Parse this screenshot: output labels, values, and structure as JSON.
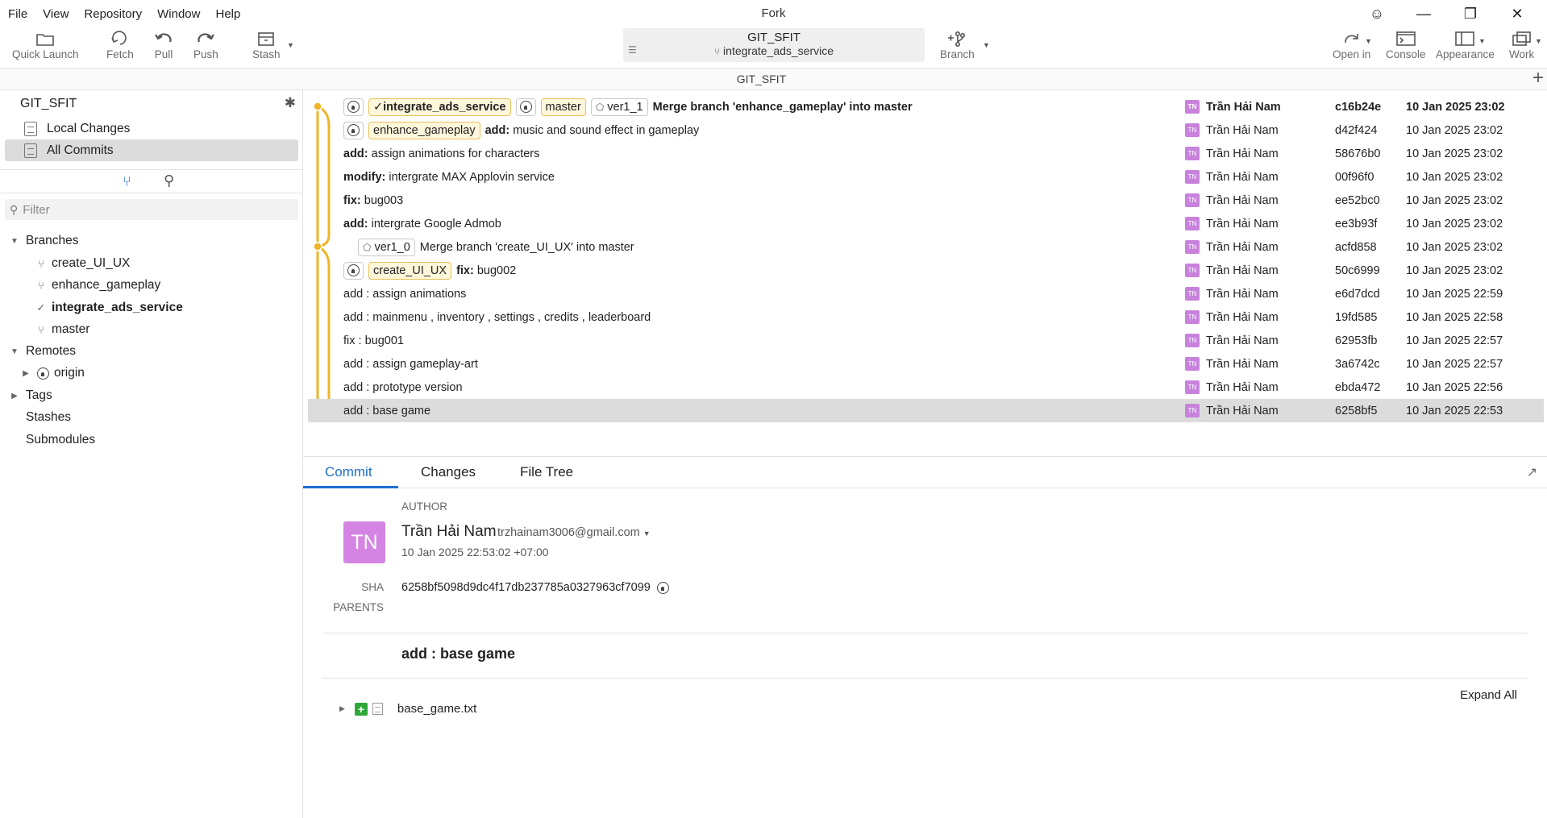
{
  "app": {
    "title": "Fork"
  },
  "menu": [
    "File",
    "View",
    "Repository",
    "Window",
    "Help"
  ],
  "toolbar": {
    "quick_launch": "Quick Launch",
    "fetch": "Fetch",
    "pull": "Pull",
    "push": "Push",
    "stash": "Stash",
    "repo_name": "GIT_SFIT",
    "current_branch": "integrate_ads_service",
    "branch": "Branch",
    "open_in": "Open in",
    "console": "Console",
    "appearance": "Appearance",
    "work": "Work"
  },
  "tab": {
    "title": "GIT_SFIT"
  },
  "sidebar": {
    "repo": "GIT_SFIT",
    "local_changes": "Local Changes",
    "all_commits": "All Commits",
    "filter_placeholder": "Filter",
    "branches_label": "Branches",
    "branches": [
      "create_UI_UX",
      "enhance_gameplay",
      "integrate_ads_service",
      "master"
    ],
    "current_branch_index": 2,
    "remotes_label": "Remotes",
    "remotes": [
      "origin"
    ],
    "tags_label": "Tags",
    "stashes_label": "Stashes",
    "submodules_label": "Submodules"
  },
  "commits": [
    {
      "refs": [
        {
          "kind": "github"
        },
        {
          "kind": "branch",
          "label": "integrate_ads_service",
          "current": true
        },
        {
          "kind": "github"
        },
        {
          "kind": "branch",
          "label": "master"
        },
        {
          "kind": "tag",
          "label": "ver1_1"
        }
      ],
      "prefix": "",
      "subject": "Merge branch 'enhance_gameplay' into master",
      "author": "Trần Hải Nam",
      "initials": "TN",
      "sha": "c16b24e",
      "date": "10 Jan 2025 23:02",
      "head": true
    },
    {
      "refs": [
        {
          "kind": "github"
        },
        {
          "kind": "branch",
          "label": "enhance_gameplay"
        }
      ],
      "prefix": "add:",
      "subject": " music and sound effect in gameplay",
      "author": "Trần Hải Nam",
      "initials": "TN",
      "sha": "d42f424",
      "date": "10 Jan 2025 23:02"
    },
    {
      "refs": [],
      "prefix": "add:",
      "subject": " assign animations for characters",
      "author": "Trần Hải Nam",
      "initials": "TN",
      "sha": "58676b0",
      "date": "10 Jan 2025 23:02"
    },
    {
      "refs": [],
      "prefix": "modify:",
      "subject": " intergrate MAX Applovin service",
      "author": "Trần Hải Nam",
      "initials": "TN",
      "sha": "00f96f0",
      "date": "10 Jan 2025 23:02"
    },
    {
      "refs": [],
      "prefix": "fix:",
      "subject": " bug003",
      "author": "Trần Hải Nam",
      "initials": "TN",
      "sha": "ee52bc0",
      "date": "10 Jan 2025 23:02"
    },
    {
      "refs": [],
      "prefix": "add:",
      "subject": " intergrate Google Admob",
      "author": "Trần Hải Nam",
      "initials": "TN",
      "sha": "ee3b93f",
      "date": "10 Jan 2025 23:02"
    },
    {
      "refs": [
        {
          "kind": "tag",
          "label": "ver1_0"
        }
      ],
      "prefix": "",
      "subject": "Merge branch 'create_UI_UX' into master",
      "author": "Trần Hải Nam",
      "initials": "TN",
      "sha": "acfd858",
      "date": "10 Jan 2025 23:02",
      "indent": true
    },
    {
      "refs": [
        {
          "kind": "github"
        },
        {
          "kind": "branch",
          "label": "create_UI_UX"
        }
      ],
      "prefix": "fix:",
      "subject": " bug002",
      "author": "Trần Hải Nam",
      "initials": "TN",
      "sha": "50c6999",
      "date": "10 Jan 2025 23:02"
    },
    {
      "refs": [],
      "prefix": "",
      "subject": "add : assign animations",
      "author": "Trần Hải Nam",
      "initials": "TN",
      "sha": "e6d7dcd",
      "date": "10 Jan 2025 22:59"
    },
    {
      "refs": [],
      "prefix": "",
      "subject": "add : mainmenu , inventory , settings , credits , leaderboard",
      "author": "Trần Hải Nam",
      "initials": "TN",
      "sha": "19fd585",
      "date": "10 Jan 2025 22:58"
    },
    {
      "refs": [],
      "prefix": "",
      "subject": "fix : bug001",
      "author": "Trần Hải Nam",
      "initials": "TN",
      "sha": "62953fb",
      "date": "10 Jan 2025 22:57"
    },
    {
      "refs": [],
      "prefix": "",
      "subject": "add : assign gameplay-art",
      "author": "Trần Hải Nam",
      "initials": "TN",
      "sha": "3a6742c",
      "date": "10 Jan 2025 22:57"
    },
    {
      "refs": [],
      "prefix": "",
      "subject": "add : prototype version",
      "author": "Trần Hải Nam",
      "initials": "TN",
      "sha": "ebda472",
      "date": "10 Jan 2025 22:56"
    },
    {
      "refs": [],
      "prefix": "",
      "subject": "add : base game",
      "author": "Trần Hải Nam",
      "initials": "TN",
      "sha": "6258bf5",
      "date": "10 Jan 2025 22:53",
      "selected": true
    }
  ],
  "details": {
    "tabs": [
      "Commit",
      "Changes",
      "File Tree"
    ],
    "author_label": "AUTHOR",
    "author_name": "Trần Hải Nam",
    "author_email": "trzhainam3006@gmail.com",
    "author_initials": "TN",
    "author_date": "10 Jan 2025 22:53:02 +07:00",
    "sha_label": "SHA",
    "sha": "6258bf5098d9dc4f17db237785a0327963cf7099",
    "parents_label": "PARENTS",
    "subject": "add : base game",
    "expand_all": "Expand All",
    "files": [
      {
        "name": "base_game.txt",
        "status": "+"
      }
    ]
  },
  "colors": {
    "accent": "#1c6fd1",
    "graph": "#f0b429",
    "avatar": "#c882dc",
    "added": "#2fa83a"
  }
}
